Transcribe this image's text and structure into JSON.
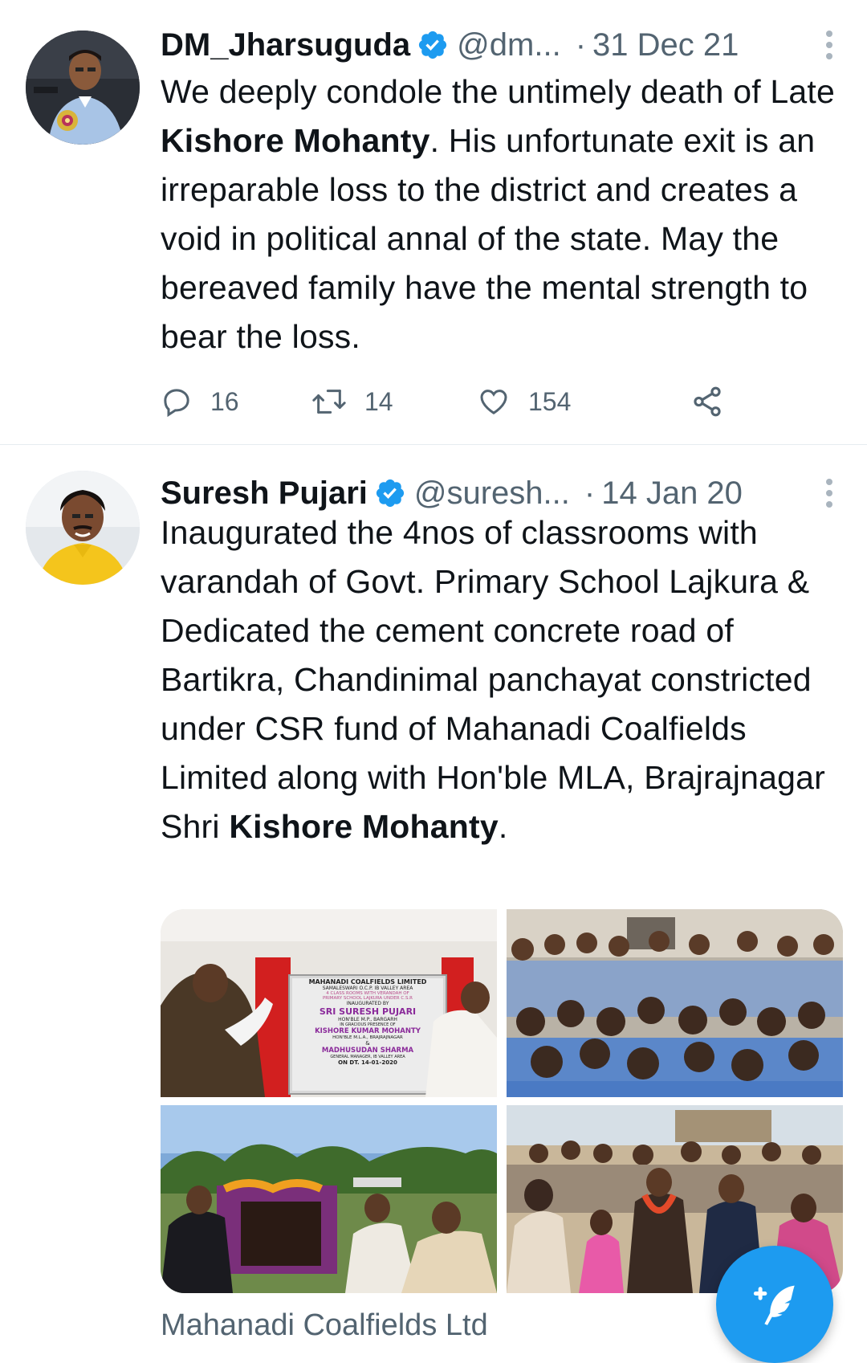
{
  "tweets": [
    {
      "name": "DM_Jharsuguda",
      "handle": "@dm...",
      "separator": "·",
      "date": "31 Dec 21",
      "text_parts": [
        "We deeply condole the untimely death of Late ",
        "Kishore Mohanty",
        ". His unfortunate exit is an irreparable loss to the district and creates a void in political annal of the state. May the bereaved family have the mental strength to bear the loss."
      ],
      "replies": "16",
      "retweets": "14",
      "likes": "154"
    },
    {
      "name": "Suresh Pujari",
      "handle": "@suresh...",
      "separator": "·",
      "date": "14 Jan 20",
      "text_parts": [
        "Inaugurated the 4nos of classrooms with varandah of Govt. Primary School Lajkura & Dedicated the cement concrete road of Bartikra, Chandinimal panchayat constricted under CSR fund of Mahanadi Coalfields Limited along with Hon'ble  MLA, Brajrajnagar Shri ",
        "Kishore Mohanty",
        "."
      ],
      "plaque_lines": [
        "MAHANADI COALFIELDS LIMITED",
        "SAMALESWARI O.C.P. IB VALLEY AREA",
        "4 CLASS ROOMS WITH VERANDAH OF",
        "PRIMARY SCHOOL LAJKURA UNDER C.S.R",
        "INAUGURATED BY",
        "SRI SURESH PUJARI",
        "HON'BLE M.P., BARGARH",
        "IN GRACIOUS PRESENCE OF",
        "KISHORE KUMAR MOHANTY",
        "HON'BLE M.L.A., BRAJRAJNAGAR",
        "&",
        "MADHUSUDAN SHARMA",
        "GENERAL MANAGER, IB VALLEY AREA",
        "ON DT. 14-01-2020"
      ],
      "source_label": "Mahanadi Coalfields Ltd"
    }
  ],
  "icons": {
    "verified": "verified-badge-icon",
    "more": "more-vertical-icon",
    "reply": "reply-icon",
    "retweet": "retweet-icon",
    "like": "heart-icon",
    "share": "share-icon",
    "compose": "compose-tweet-icon"
  },
  "colors": {
    "accent": "#1d9bf0",
    "secondary_text": "#536471",
    "divider": "#e6ecf0"
  }
}
